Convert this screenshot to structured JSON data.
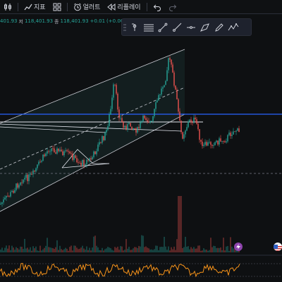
{
  "toolbar": {
    "indicators_label": "지표",
    "alert_label": "얼러트",
    "replay_label": "리플레이"
  },
  "legend": {
    "open_value": "401.93",
    "low_label": "저",
    "low_value": "118,401.93",
    "close_label": "종",
    "close_value": "118,401.93",
    "change": "+0.01",
    "change_pct": "(+0.00"
  },
  "drawing_toolbar": {
    "tools": [
      "grip-icon",
      "pin-icon",
      "channel-icon",
      "trendline-icon",
      "ray-icon",
      "horizontal-line-icon",
      "brush-icon",
      "pencil-icon",
      "pattern-icon"
    ]
  },
  "colors": {
    "background": "#0e1012",
    "up": "#26a69a",
    "down": "#ef5350",
    "blue_line": "#2962ff",
    "white_line": "#e0e3eb",
    "channel_line": "#c9cbd2",
    "oscillator": "#f7931a",
    "accent_purple": "#8e44ad"
  }
}
